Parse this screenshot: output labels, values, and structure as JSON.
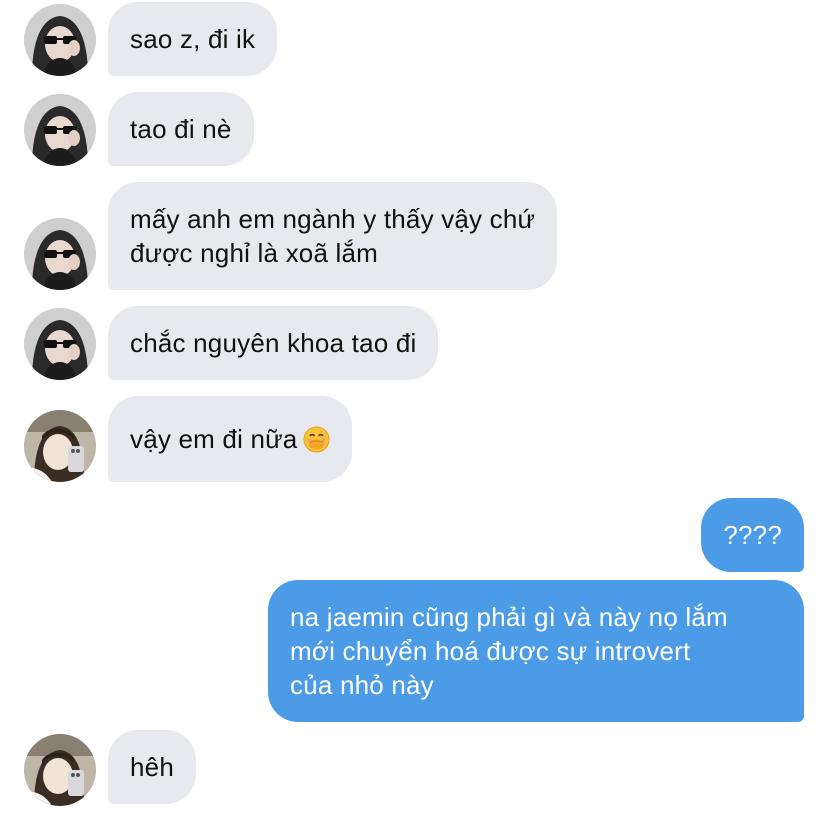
{
  "messages": [
    {
      "side": "in",
      "avatar": "avatar-sunglasses",
      "lines": [
        "sao z, đi ik"
      ]
    },
    {
      "side": "in",
      "avatar": "avatar-sunglasses",
      "lines": [
        "tao đi nè"
      ]
    },
    {
      "side": "in",
      "avatar": "avatar-sunglasses",
      "lines": [
        "mấy anh em ngành y thấy vậy chứ",
        "được nghỉ là xoã lắm"
      ]
    },
    {
      "side": "in",
      "avatar": "avatar-sunglasses",
      "lines": [
        "chắc nguyên khoa tao đi"
      ]
    },
    {
      "side": "in",
      "avatar": "avatar-phone",
      "lines": [
        "vậy em đi nữa"
      ],
      "emoji": "hand-over-mouth-emoji"
    },
    {
      "side": "out",
      "lines": [
        "????"
      ]
    },
    {
      "side": "out",
      "lines": [
        "na jaemin cũng phải gì và này nọ lắm",
        "mới chuyển hoá được sự introvert",
        "của nhỏ này"
      ]
    },
    {
      "side": "in",
      "avatar": "avatar-phone",
      "lines": [
        "hêh"
      ]
    }
  ],
  "colors": {
    "incoming_bubble": "#e7e9ee",
    "outgoing_bubble": "#4b9be6",
    "incoming_text": "#111111",
    "outgoing_text": "#ffffff"
  }
}
